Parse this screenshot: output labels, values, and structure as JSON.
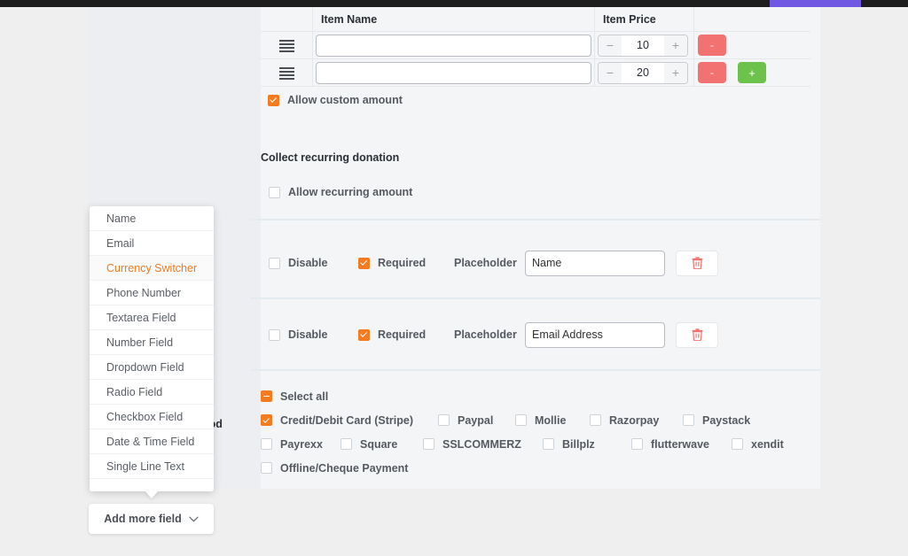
{
  "topbar": {
    "accent_color": "#7158e2",
    "bar_color": "#1e1e1e"
  },
  "items_table": {
    "columns": [
      "",
      "Item Name",
      "Item Price",
      ""
    ],
    "rows": [
      {
        "handle": "drag-handle",
        "name": "",
        "price": "10",
        "remove_label": "-",
        "add_label": ""
      },
      {
        "handle": "drag-handle",
        "name": "",
        "price": "20",
        "remove_label": "-",
        "add_label": "+"
      }
    ],
    "decrement_label": "−",
    "increment_label": "+"
  },
  "allow_custom": {
    "label": "Allow custom amount",
    "checked": true
  },
  "recurring": {
    "heading": "Collect recurring donation",
    "option_label": "Allow recurring amount",
    "checked": false
  },
  "field_rows": [
    {
      "disable_label": "Disable",
      "disable_checked": false,
      "required_label": "Required",
      "required_checked": true,
      "placeholder_label": "Placeholder",
      "placeholder_value": "Name",
      "delete_icon": "trash-icon"
    },
    {
      "disable_label": "Disable",
      "disable_checked": false,
      "required_label": "Required",
      "required_checked": true,
      "placeholder_label": "Placeholder",
      "placeholder_value": "Email Address",
      "delete_icon": "trash-icon"
    }
  ],
  "payment_methods": {
    "hidden_heading": "nod",
    "select_all_label": "Select all",
    "select_all_state": "indeterminate",
    "row1": [
      {
        "label": "Credit/Debit Card (Stripe)",
        "checked": true
      },
      {
        "label": "Paypal",
        "checked": false
      },
      {
        "label": "Mollie",
        "checked": false
      },
      {
        "label": "Razorpay",
        "checked": false
      },
      {
        "label": "Paystack",
        "checked": false
      }
    ],
    "row2": [
      {
        "label": "Payrexx",
        "checked": false
      },
      {
        "label": "Square",
        "checked": false
      },
      {
        "label": "SSLCOMMERZ",
        "checked": false
      },
      {
        "label": "Billplz",
        "checked": false
      },
      {
        "label": "flutterwave",
        "checked": false
      },
      {
        "label": "xendit",
        "checked": false
      }
    ],
    "row3": [
      {
        "label": "Offline/Cheque Payment",
        "checked": false
      }
    ]
  },
  "dropdown": {
    "items": [
      {
        "label": "Name",
        "active": false
      },
      {
        "label": "Email",
        "active": false
      },
      {
        "label": "Currency Switcher",
        "active": true
      },
      {
        "label": "Phone Number",
        "active": false
      },
      {
        "label": "Textarea Field",
        "active": false
      },
      {
        "label": "Number Field",
        "active": false
      },
      {
        "label": "Dropdown Field",
        "active": false
      },
      {
        "label": "Radio Field",
        "active": false
      },
      {
        "label": "Checkbox Field",
        "active": false
      },
      {
        "label": "Date & Time Field",
        "active": false
      },
      {
        "label": "Single Line Text",
        "active": false
      }
    ],
    "active_color": "#f47b20"
  },
  "add_more_field": {
    "label": "Add more field",
    "chevron": "chevron-down-icon"
  },
  "colors": {
    "accent": "#f47b20",
    "danger": "#f27272",
    "success": "#6cc24a"
  }
}
